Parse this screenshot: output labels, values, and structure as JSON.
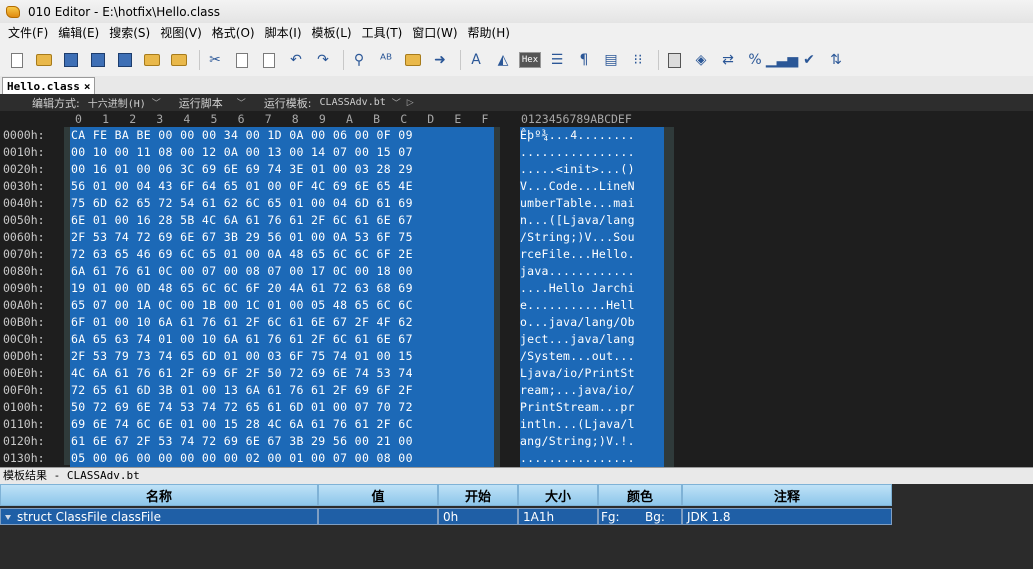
{
  "window": {
    "title": "010 Editor - E:\\hotfix\\Hello.class"
  },
  "menu": [
    "文件(F)",
    "编辑(E)",
    "搜索(S)",
    "视图(V)",
    "格式(O)",
    "脚本(I)",
    "模板(L)",
    "工具(T)",
    "窗口(W)",
    "帮助(H)"
  ],
  "toolbar": {
    "icons": [
      "new-file-icon",
      "open-folder-icon",
      "save-icon",
      "save-as-icon",
      "save-all-icon",
      "open-dir-icon",
      "open-files-icon",
      "cut-icon",
      "copy-icon",
      "paste-icon",
      "undo-icon",
      "redo-icon",
      "find-icon",
      "replace-icon",
      "find-in-files-icon",
      "goto-icon",
      "font-icon",
      "highlight-icon",
      "hex-icon",
      "columns-icon",
      "paragraph-icon",
      "layout-icon",
      "binary-icon",
      "calculator-icon",
      "bookmark-icon",
      "swap-icon",
      "percent-icon",
      "histogram-icon",
      "checksum-icon",
      "base-convert-icon"
    ],
    "hex_label": "Hex"
  },
  "tab": {
    "label": "Hello.class",
    "close": "×"
  },
  "infobar": {
    "edit_mode_label": "编辑方式:",
    "edit_mode_value": "十六进制(H)",
    "run_script_label": "运行脚本",
    "run_template_label": "运行模板:",
    "run_template_value": "CLASSAdv.bt"
  },
  "columns": {
    "hex": [
      "0",
      "1",
      "2",
      "3",
      "4",
      "5",
      "6",
      "7",
      "8",
      "9",
      "A",
      "B",
      "C",
      "D",
      "E",
      "F"
    ],
    "ascii": "0123456789ABCDEF"
  },
  "rows": [
    {
      "offset": "0000h:",
      "hex": "CA FE BA BE 00 00 00 34 00 1D 0A 00 06 00 0F 09",
      "ascii": "Êþº¾...4........"
    },
    {
      "offset": "0010h:",
      "hex": "00 10 00 11 08 00 12 0A 00 13 00 14 07 00 15 07",
      "ascii": "................"
    },
    {
      "offset": "0020h:",
      "hex": "00 16 01 00 06 3C 69 6E 69 74 3E 01 00 03 28 29",
      "ascii": ".....<init>...()"
    },
    {
      "offset": "0030h:",
      "hex": "56 01 00 04 43 6F 64 65 01 00 0F 4C 69 6E 65 4E",
      "ascii": "V...Code...LineN"
    },
    {
      "offset": "0040h:",
      "hex": "75 6D 62 65 72 54 61 62 6C 65 01 00 04 6D 61 69",
      "ascii": "umberTable...mai"
    },
    {
      "offset": "0050h:",
      "hex": "6E 01 00 16 28 5B 4C 6A 61 76 61 2F 6C 61 6E 67",
      "ascii": "n...([Ljava/lang"
    },
    {
      "offset": "0060h:",
      "hex": "2F 53 74 72 69 6E 67 3B 29 56 01 00 0A 53 6F 75",
      "ascii": "/String;)V...Sou"
    },
    {
      "offset": "0070h:",
      "hex": "72 63 65 46 69 6C 65 01 00 0A 48 65 6C 6C 6F 2E",
      "ascii": "rceFile...Hello."
    },
    {
      "offset": "0080h:",
      "hex": "6A 61 76 61 0C 00 07 00 08 07 00 17 0C 00 18 00",
      "ascii": "java............"
    },
    {
      "offset": "0090h:",
      "hex": "19 01 00 0D 48 65 6C 6C 6F 20 4A 61 72 63 68 69",
      "ascii": "....Hello Jarchi"
    },
    {
      "offset": "00A0h:",
      "hex": "65 07 00 1A 0C 00 1B 00 1C 01 00 05 48 65 6C 6C",
      "ascii": "e...........Hell"
    },
    {
      "offset": "00B0h:",
      "hex": "6F 01 00 10 6A 61 76 61 2F 6C 61 6E 67 2F 4F 62",
      "ascii": "o...java/lang/Ob"
    },
    {
      "offset": "00C0h:",
      "hex": "6A 65 63 74 01 00 10 6A 61 76 61 2F 6C 61 6E 67",
      "ascii": "ject...java/lang"
    },
    {
      "offset": "00D0h:",
      "hex": "2F 53 79 73 74 65 6D 01 00 03 6F 75 74 01 00 15",
      "ascii": "/System...out..."
    },
    {
      "offset": "00E0h:",
      "hex": "4C 6A 61 76 61 2F 69 6F 2F 50 72 69 6E 74 53 74",
      "ascii": "Ljava/io/PrintSt"
    },
    {
      "offset": "00F0h:",
      "hex": "72 65 61 6D 3B 01 00 13 6A 61 76 61 2F 69 6F 2F",
      "ascii": "ream;...java/io/"
    },
    {
      "offset": "0100h:",
      "hex": "50 72 69 6E 74 53 74 72 65 61 6D 01 00 07 70 72",
      "ascii": "PrintStream...pr"
    },
    {
      "offset": "0110h:",
      "hex": "69 6E 74 6C 6E 01 00 15 28 4C 6A 61 76 61 2F 6C",
      "ascii": "intln...(Ljava/l"
    },
    {
      "offset": "0120h:",
      "hex": "61 6E 67 2F 53 74 72 69 6E 67 3B 29 56 00 21 00",
      "ascii": "ang/String;)V.!."
    },
    {
      "offset": "0130h:",
      "hex": "05 00 06 00 00 00 00 00 02 00 01 00 07 00 08 00",
      "ascii": "................"
    }
  ],
  "results": {
    "title": "模板结果 - CLASSAdv.bt",
    "headers": [
      "名称",
      "值",
      "开始",
      "大小",
      "颜色",
      "注释"
    ],
    "row": {
      "name": "struct ClassFile classFile",
      "value": "",
      "start": "0h",
      "size": "1A1h",
      "fg": "Fg:",
      "bg": "Bg:",
      "comment": "JDK 1.8"
    }
  },
  "colors": {
    "selection": "#1c69b7",
    "editor_bg": "#1e1e1e",
    "header_blue": "#8dc6ea"
  }
}
